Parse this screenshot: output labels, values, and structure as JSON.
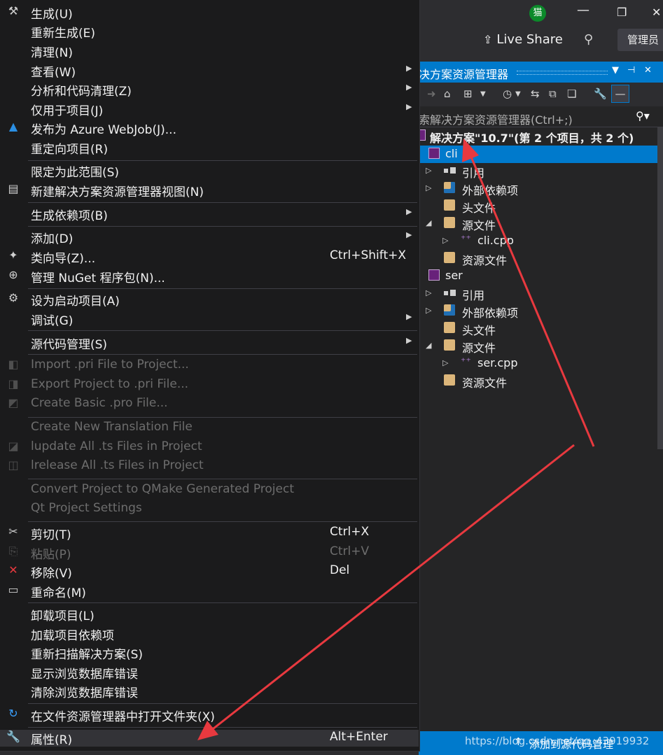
{
  "titlebar": {
    "avatar_initial": "猫",
    "minimize_glyph": "—",
    "restore_glyph": "❐",
    "close_glyph": "✕",
    "live_share": "Live Share",
    "admin": "管理员"
  },
  "solution_explorer": {
    "title": "决方案资源管理器",
    "search_placeholder": "索解决方案资源管理器(Ctrl+;)",
    "tree": [
      {
        "label": "解决方案\"10.7\"(第 2 个项目，共 2 个)",
        "icon": "solution-icon"
      },
      {
        "label": "cli",
        "icon": "project-icon"
      },
      {
        "label": "引用",
        "icon": "references-icon"
      },
      {
        "label": "外部依赖项",
        "icon": "external-deps-icon"
      },
      {
        "label": "头文件",
        "icon": "folder-icon"
      },
      {
        "label": "源文件",
        "icon": "folder-open-icon"
      },
      {
        "label": "cli.cpp",
        "icon": "cpp-file-icon"
      },
      {
        "label": "资源文件",
        "icon": "folder-icon"
      },
      {
        "label": "ser",
        "icon": "project-icon"
      },
      {
        "label": "引用",
        "icon": "references-icon"
      },
      {
        "label": "外部依赖项",
        "icon": "external-deps-icon"
      },
      {
        "label": "头文件",
        "icon": "folder-icon"
      },
      {
        "label": "源文件",
        "icon": "folder-open-icon"
      },
      {
        "label": "ser.cpp",
        "icon": "cpp-file-icon"
      },
      {
        "label": "资源文件",
        "icon": "folder-icon"
      }
    ]
  },
  "statusbar": {
    "text": "添加到源代码管理",
    "watermark": "https://blog.csdn.net/qq_43919932"
  },
  "menu": {
    "items": [
      {
        "label": "生成(U)",
        "icon": "build-icon"
      },
      {
        "label": "重新生成(E)"
      },
      {
        "label": "清理(N)"
      },
      {
        "label": "查看(W)",
        "submenu": true
      },
      {
        "label": "分析和代码清理(Z)",
        "submenu": true
      },
      {
        "label": "仅用于项目(J)",
        "submenu": true
      },
      {
        "label": "发布为 Azure WebJob(J)...",
        "icon": "azure-icon"
      },
      {
        "label": "重定向项目(R)"
      },
      {
        "label": "限定为此范围(S)"
      },
      {
        "label": "新建解决方案资源管理器视图(N)",
        "icon": "new-view-icon"
      },
      {
        "label": "生成依赖项(B)",
        "submenu": true
      },
      {
        "label": "添加(D)",
        "submenu": true
      },
      {
        "label": "类向导(Z)...",
        "shortcut": "Ctrl+Shift+X",
        "icon": "class-wizard-icon"
      },
      {
        "label": "管理 NuGet 程序包(N)...",
        "icon": "nuget-icon"
      },
      {
        "label": "设为启动项目(A)",
        "icon": "gear-icon"
      },
      {
        "label": "调试(G)",
        "submenu": true
      },
      {
        "label": "源代码管理(S)",
        "submenu": true
      },
      {
        "label": "Import .pri File to Project...",
        "disabled": true,
        "icon": "import-icon"
      },
      {
        "label": "Export Project to .pri File...",
        "disabled": true,
        "icon": "export-icon"
      },
      {
        "label": "Create Basic .pro File...",
        "disabled": true,
        "icon": "pro-file-icon"
      },
      {
        "label": "Create New Translation File",
        "disabled": true
      },
      {
        "label": "lupdate All .ts Files in Project",
        "disabled": true,
        "icon": "lupdate-icon"
      },
      {
        "label": "lrelease All .ts Files in Project",
        "disabled": true,
        "icon": "lrelease-icon"
      },
      {
        "label": "Convert Project to QMake Generated Project",
        "disabled": true
      },
      {
        "label": "Qt Project Settings",
        "disabled": true
      },
      {
        "label": "剪切(T)",
        "shortcut": "Ctrl+X",
        "icon": "scissors-icon"
      },
      {
        "label": "粘贴(P)",
        "shortcut": "Ctrl+V",
        "disabled": true,
        "icon": "paste-icon"
      },
      {
        "label": "移除(V)",
        "shortcut": "Del",
        "icon": "remove-icon"
      },
      {
        "label": "重命名(M)",
        "icon": "rename-icon"
      },
      {
        "label": "卸载项目(L)"
      },
      {
        "label": "加载项目依赖项"
      },
      {
        "label": "重新扫描解决方案(S)"
      },
      {
        "label": "显示浏览数据库错误"
      },
      {
        "label": "清除浏览数据库错误"
      },
      {
        "label": "在文件资源管理器中打开文件夹(X)",
        "icon": "open-folder-icon"
      },
      {
        "label": "属性(R)",
        "shortcut": "Alt+Enter",
        "icon": "wrench-icon"
      }
    ]
  },
  "colors": {
    "accent": "#007acc",
    "menu_bg": "#1b1b1c",
    "annotation_arrow": "#e8393f"
  }
}
